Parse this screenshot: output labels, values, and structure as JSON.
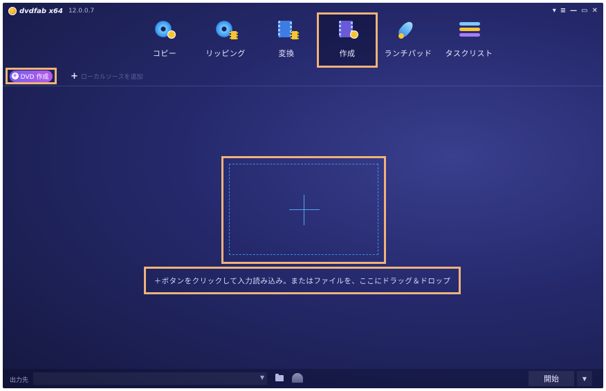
{
  "app": {
    "name": "dvdfab x64",
    "version": "12.0.0.7"
  },
  "window_controls": [
    "▾",
    "≡",
    "—",
    "▭",
    "✕"
  ],
  "nav": {
    "tabs": [
      {
        "label": "コピー",
        "icon": "disc-plus-icon"
      },
      {
        "label": "リッピング",
        "icon": "disc-film-icon"
      },
      {
        "label": "変換",
        "icon": "film-icon"
      },
      {
        "label": "作成",
        "icon": "film-create-icon",
        "active": true
      },
      {
        "label": "ランチパッド",
        "icon": "rocket-icon"
      },
      {
        "label": "タスクリスト",
        "icon": "task-list-icon"
      }
    ]
  },
  "toolbar": {
    "mode_button": "DVD 作成",
    "add_local": "ローカルソースを追加"
  },
  "main": {
    "hint": "＋ボタンをクリックして入力読み込み。またはファイルを、ここにドラッグ＆ドロップ"
  },
  "bottom": {
    "output_label": "出力先",
    "output_value": "",
    "start_label": "開始"
  },
  "colors": {
    "highlight": "#f0b37a",
    "background": "#262a6e",
    "accent": "#7b5cf0",
    "dropzone": "#3c8fe0"
  }
}
